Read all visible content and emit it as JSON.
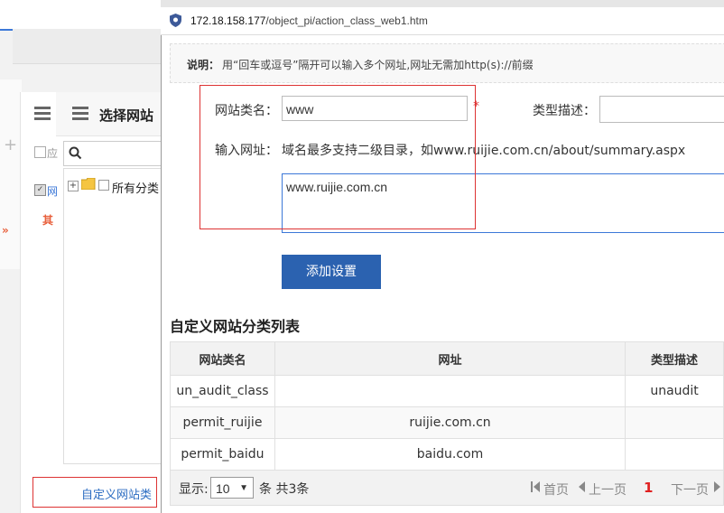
{
  "background": {
    "select_panel_title": "选择网站",
    "tree_root_label": "所有分类",
    "bottom_link": "自定义网站类",
    "side_labels": [
      "应",
      "网",
      "其"
    ]
  },
  "browser": {
    "url_host": "172.18.158.177",
    "url_path": "/object_pi/action_class_web1.htm"
  },
  "notice": {
    "label": "说明：",
    "text": "用“回车或逗号”隔开可以输入多个网址,网址无需加http(s)://前缀"
  },
  "form": {
    "name_label": "网站类名：",
    "name_value": "www",
    "required_mark": "*",
    "desc_label": "类型描述：",
    "url_label": "输入网址：",
    "url_hint": "域名最多支持二级目录，如www.ruijie.com.cn/about/summary.aspx",
    "url_value": "www.ruijie.com.cn",
    "add_button": "添加设置"
  },
  "list": {
    "title": "自定义网站分类列表",
    "columns": [
      "网站类名",
      "网址",
      "类型描述"
    ],
    "rows": [
      [
        "un_audit_class",
        "",
        "unaudit"
      ],
      [
        "permit_ruijie",
        "ruijie.com.cn",
        ""
      ],
      [
        "permit_baidu",
        "baidu.com",
        ""
      ]
    ]
  },
  "pager": {
    "show_label": "显示:",
    "page_size": "10",
    "count_text": "条 共3条",
    "first": "首页",
    "prev": "上一页",
    "current": "1",
    "next": "下一页"
  },
  "colors": {
    "primary": "#2b62b0",
    "highlight_border": "#dd3333",
    "current_page": "#e02020"
  }
}
